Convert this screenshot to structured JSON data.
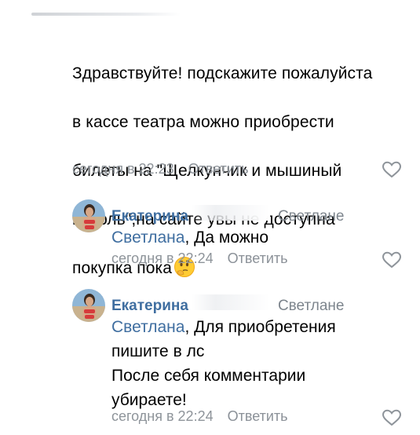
{
  "main_comment": {
    "lines": [
      "Здравствуйте! подскажите пожалуйста",
      "в кассе театра можно приобрести",
      "билеты на \"Щелкунчик и мышиный",
      "король\",на сайте увы не доступна",
      "покупка пока"
    ],
    "emoji": "thinking-face",
    "timestamp": "сегодня в 22:23",
    "reply_label": "Ответить"
  },
  "replies": [
    {
      "author": "Екатерина",
      "reply_to": "Светлане",
      "mention": "Светлана",
      "text_lines": [
        ", Да можно"
      ],
      "timestamp": "сегодня в 22:24",
      "reply_label": "Ответить"
    },
    {
      "author": "Екатерина",
      "reply_to": "Светлане",
      "mention": "Светлана",
      "text_lines": [
        ", Для приобретения",
        "пишите в лс",
        "После себя комментарии",
        "убираете!"
      ],
      "timestamp": "сегодня в 22:24",
      "reply_label": "Ответить"
    }
  ],
  "colors": {
    "link": "#3f6ea0",
    "meta": "#8e949a",
    "heart_outline": "#8e949a"
  }
}
